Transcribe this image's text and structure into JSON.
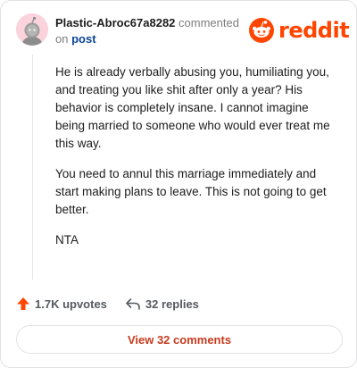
{
  "comment": {
    "username": "Plastic-Abroc67a8282",
    "action_text": "commented",
    "on_text": "on",
    "post_link": "post",
    "paragraphs": [
      "He is already verbally abusing you, humiliating you, and treating you like shit after only a year? His behavior is completely insane. I cannot imagine being married to someone who would ever treat me this way.",
      "You need to annul this marriage immediately and start making plans to leave. This is not going to get better.",
      "NTA"
    ],
    "upvotes": "1.7K upvotes",
    "replies": "32 replies",
    "view_button": "View 32 comments"
  },
  "brand": {
    "wordmark": "reddit",
    "color": "#ff4500"
  },
  "icons": {
    "avatar": "snoo-avatar",
    "logo": "reddit-snoo-icon",
    "upvote": "upvote-arrow-icon",
    "reply": "reply-arrow-icon"
  }
}
